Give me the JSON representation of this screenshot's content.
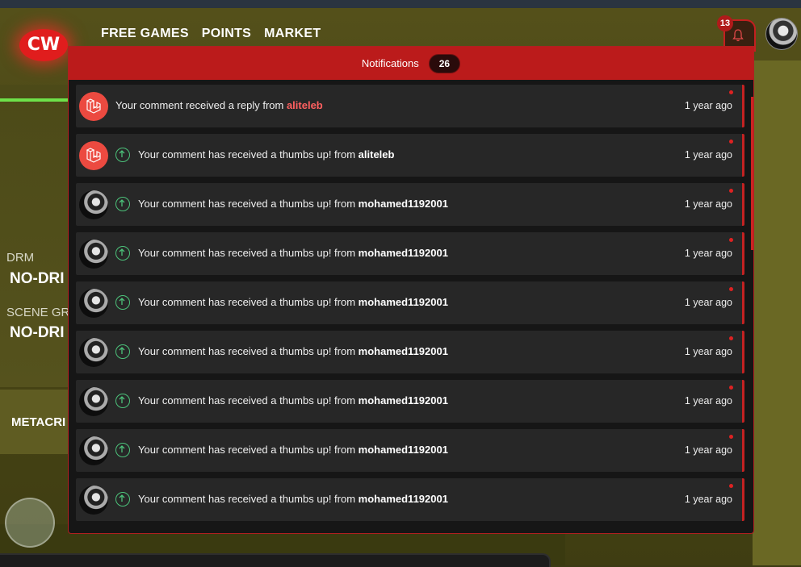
{
  "site": {
    "logo_text": "CW"
  },
  "nav": [
    {
      "label": "FREE GAMES"
    },
    {
      "label": "POINTS"
    },
    {
      "label": "MARKET"
    }
  ],
  "header": {
    "bell_badge": "13"
  },
  "background": {
    "drm_label": "DRM",
    "drm_value": "NO-DRI",
    "scene_label": "SCENE GR",
    "scene_value": "NO-DRI",
    "metacritic": "METACRI"
  },
  "notifications": {
    "title": "Notifications",
    "count": "26",
    "items": [
      {
        "avatar": "laravel-icon",
        "arrow": false,
        "text": "Your comment received a reply from ",
        "user": "aliteleb",
        "user_color": "red",
        "time": "1 year ago"
      },
      {
        "avatar": "laravel-icon",
        "arrow": true,
        "text": "Your comment has received a thumbs up! from ",
        "user": "aliteleb",
        "user_color": "white",
        "time": "1 year ago"
      },
      {
        "avatar": "user-avatar",
        "arrow": true,
        "text": "Your comment has received a thumbs up! from ",
        "user": "mohamed1192001",
        "user_color": "white",
        "time": "1 year ago"
      },
      {
        "avatar": "user-avatar",
        "arrow": true,
        "text": "Your comment has received a thumbs up! from ",
        "user": "mohamed1192001",
        "user_color": "white",
        "time": "1 year ago"
      },
      {
        "avatar": "user-avatar",
        "arrow": true,
        "text": "Your comment has received a thumbs up! from ",
        "user": "mohamed1192001",
        "user_color": "white",
        "time": "1 year ago"
      },
      {
        "avatar": "user-avatar",
        "arrow": true,
        "text": "Your comment has received a thumbs up! from ",
        "user": "mohamed1192001",
        "user_color": "white",
        "time": "1 year ago"
      },
      {
        "avatar": "user-avatar",
        "arrow": true,
        "text": "Your comment has received a thumbs up! from ",
        "user": "mohamed1192001",
        "user_color": "white",
        "time": "1 year ago"
      },
      {
        "avatar": "user-avatar",
        "arrow": true,
        "text": "Your comment has received a thumbs up! from ",
        "user": "mohamed1192001",
        "user_color": "white",
        "time": "1 year ago"
      },
      {
        "avatar": "user-avatar",
        "arrow": true,
        "text": "Your comment has received a thumbs up! from ",
        "user": "mohamed1192001",
        "user_color": "white",
        "time": "1 year ago"
      }
    ]
  },
  "colors": {
    "accent": "#bb1b1b",
    "link_red": "#ff6060",
    "success_green": "#4cc27a"
  }
}
